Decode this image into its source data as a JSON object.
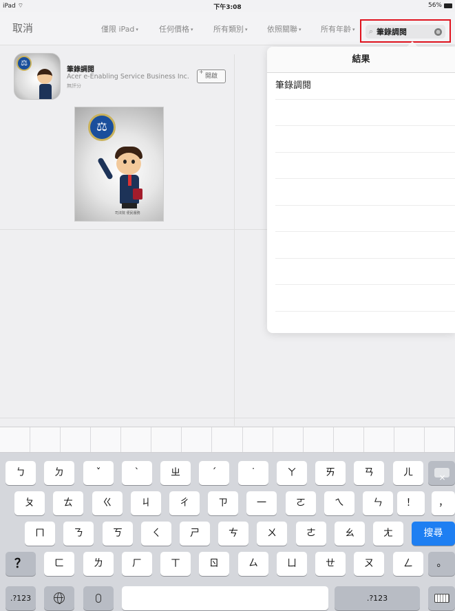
{
  "status_bar": {
    "device": "iPad",
    "wifi": "⌔",
    "time": "下午3:08",
    "battery": "56%"
  },
  "navbar": {
    "cancel": "取消",
    "filters": [
      "僅限 iPad",
      "任何價格",
      "所有類別",
      "依照關聯",
      "所有年齡"
    ],
    "search": {
      "value": "筆錄調閱",
      "mag_icon": "⌕",
      "clear_icon": "⊗"
    }
  },
  "app": {
    "name": "筆錄調閱",
    "developer": "Acer e-Enabling Service Business Inc.",
    "rating": "無評分",
    "open_button": "開啟",
    "open_plus": "+",
    "emblem": "⚖",
    "screenshot_caption": "司法院 便民服務"
  },
  "results": {
    "header": "結果",
    "rows": [
      "筆錄調閱",
      "",
      "",
      "",
      "",
      "",
      "",
      "",
      "",
      ""
    ]
  },
  "keyboard": {
    "row1": [
      "ㄅ",
      "ㄉ",
      "ˇ",
      "ˋ",
      "ㄓ",
      "ˊ",
      "˙",
      "ㄚ",
      "ㄞ",
      "ㄢ",
      "ㄦ"
    ],
    "row2": [
      "ㄆ",
      "ㄊ",
      "ㄍ",
      "ㄐ",
      "ㄔ",
      "ㄗ",
      "一",
      "ㄛ",
      "ㄟ",
      "ㄣ",
      "！",
      "，"
    ],
    "row3": [
      "ㄇ",
      "ㄋ",
      "ㄎ",
      "ㄑ",
      "ㄕ",
      "ㄘ",
      "ㄨ",
      "ㄜ",
      "ㄠ",
      "ㄤ"
    ],
    "row4": [
      "？",
      "ㄈ",
      "ㄌ",
      "ㄏ",
      "ㄒ",
      "ㄖ",
      "ㄙ",
      "ㄩ",
      "ㄝ",
      "ㄡ",
      "ㄥ",
      "。"
    ],
    "search_key": "搜尋",
    "numbers_left": ".?123",
    "numbers_right": ".?123"
  },
  "colors": {
    "highlight": "#e0121d",
    "search_key": "#1e7ff2"
  }
}
